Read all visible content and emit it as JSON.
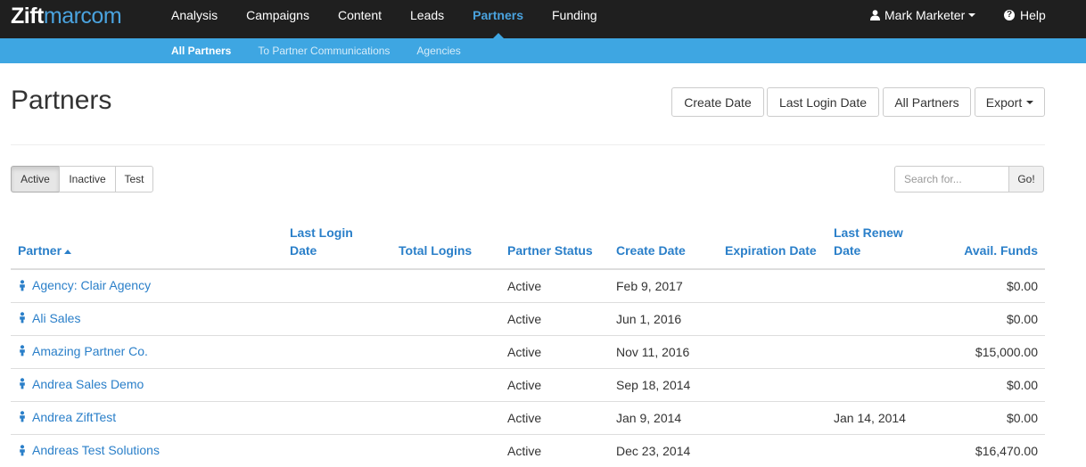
{
  "logo": {
    "bold": "Zift",
    "light": "marcom"
  },
  "nav": {
    "items": [
      {
        "label": "Analysis"
      },
      {
        "label": "Campaigns"
      },
      {
        "label": "Content"
      },
      {
        "label": "Leads"
      },
      {
        "label": "Partners"
      },
      {
        "label": "Funding"
      }
    ],
    "user": "Mark Marketer",
    "help": "Help"
  },
  "subnav": {
    "items": [
      {
        "label": "All Partners"
      },
      {
        "label": "To Partner Communications"
      },
      {
        "label": "Agencies"
      }
    ]
  },
  "page": {
    "title": "Partners",
    "buttons": {
      "create_date": "Create Date",
      "last_login_date": "Last Login Date",
      "all_partners": "All Partners",
      "export": "Export"
    }
  },
  "filters": {
    "active": "Active",
    "inactive": "Inactive",
    "test": "Test"
  },
  "search": {
    "placeholder": "Search for...",
    "go": "Go!"
  },
  "table": {
    "headers": {
      "partner": "Partner",
      "last_login_1": "Last Login",
      "last_login_2": "Date",
      "total_logins": "Total Logins",
      "partner_status": "Partner Status",
      "create_date": "Create Date",
      "expiration_date": "Expiration Date",
      "last_renew_1": "Last Renew",
      "last_renew_2": "Date",
      "avail_funds": "Avail. Funds"
    },
    "rows": [
      {
        "partner": "Agency: Clair Agency",
        "last_login": "",
        "total_logins": "",
        "status": "Active",
        "create_date": "Feb 9, 2017",
        "expiration": "",
        "last_renew": "",
        "funds": "$0.00"
      },
      {
        "partner": "Ali Sales",
        "last_login": "",
        "total_logins": "",
        "status": "Active",
        "create_date": "Jun 1, 2016",
        "expiration": "",
        "last_renew": "",
        "funds": "$0.00"
      },
      {
        "partner": "Amazing Partner Co.",
        "last_login": "",
        "total_logins": "",
        "status": "Active",
        "create_date": "Nov 11, 2016",
        "expiration": "",
        "last_renew": "",
        "funds": "$15,000.00"
      },
      {
        "partner": "Andrea Sales Demo",
        "last_login": "",
        "total_logins": "",
        "status": "Active",
        "create_date": "Sep 18, 2014",
        "expiration": "",
        "last_renew": "",
        "funds": "$0.00"
      },
      {
        "partner": "Andrea ZiftTest",
        "last_login": "",
        "total_logins": "",
        "status": "Active",
        "create_date": "Jan 9, 2014",
        "expiration": "",
        "last_renew": "Jan 14, 2014",
        "funds": "$0.00"
      },
      {
        "partner": "Andreas Test Solutions",
        "last_login": "",
        "total_logins": "",
        "status": "Active",
        "create_date": "Dec 23, 2014",
        "expiration": "",
        "last_renew": "",
        "funds": "$16,470.00"
      }
    ]
  }
}
